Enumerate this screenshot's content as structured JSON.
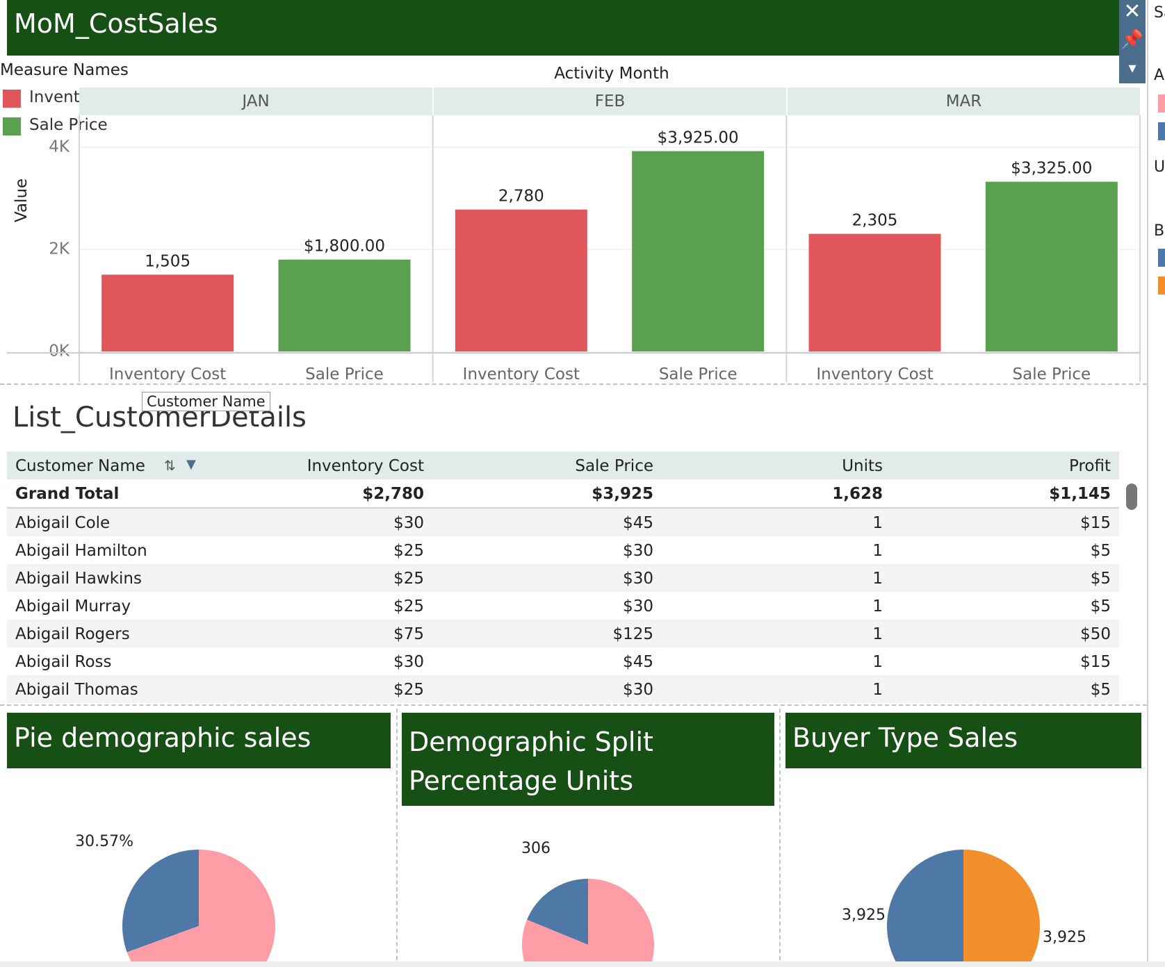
{
  "dashboard": {
    "bar_title": "MoM_CostSales",
    "legend": {
      "title": "Measure Names",
      "items": [
        {
          "label": "Inventory C..",
          "color": "#e0565b"
        },
        {
          "label": "Sale Price",
          "color": "#59a14f"
        }
      ]
    },
    "column_header_title": "Activity Month",
    "y_axis_label": "Value",
    "months": [
      "JAN",
      "FEB",
      "MAR"
    ],
    "x_labels": [
      "Inventory Cost",
      "Sale Price"
    ],
    "tooltip": "Customer Name"
  },
  "chart_data": [
    {
      "type": "bar",
      "categories": [
        "JAN",
        "FEB",
        "MAR"
      ],
      "sub_categories": [
        "Inventory Cost",
        "Sale Price"
      ],
      "series": [
        {
          "name": "Inventory Cost",
          "values": [
            1505,
            2780,
            2305
          ],
          "labels": [
            "1,505",
            "2,780",
            "2,305"
          ],
          "color": "#e0565b"
        },
        {
          "name": "Sale Price",
          "values": [
            1800,
            3925,
            3325
          ],
          "labels": [
            "$1,800.00",
            "$3,925.00",
            "$3,325.00"
          ],
          "color": "#59a14f"
        }
      ],
      "ylabel": "Value",
      "ylim": [
        0,
        4000
      ],
      "yticks": [
        {
          "value": 0,
          "label": "0K"
        },
        {
          "value": 2000,
          "label": "2K"
        },
        {
          "value": 4000,
          "label": "4K"
        }
      ],
      "grid": true
    },
    {
      "type": "pie",
      "title": "Pie demographic sales",
      "slices": [
        {
          "value": 30.57,
          "label": "30.57%",
          "color": "#4e79a7"
        },
        {
          "value": 69.43,
          "label": "",
          "color": "#ff9da7"
        }
      ]
    },
    {
      "type": "pie",
      "title": "Demographic Split Percentage Units",
      "slices": [
        {
          "value": 306,
          "label": "306",
          "color": "#4e79a7"
        },
        {
          "value": 1322,
          "label": "",
          "color": "#ff9da7"
        }
      ]
    },
    {
      "type": "pie",
      "title": "Buyer Type Sales",
      "slices": [
        {
          "value": 3925,
          "label": "3,925",
          "color": "#4e79a7"
        },
        {
          "value": 3925,
          "label": "3,925",
          "color": "#f28e2b"
        }
      ]
    }
  ],
  "table": {
    "title": "List_CustomerDetails",
    "columns": [
      "Customer Name",
      "Inventory Cost",
      "Sale Price",
      "Units",
      "Profit"
    ],
    "grand_total": [
      "Grand Total",
      "$2,780",
      "$3,925",
      "1,628",
      "$1,145"
    ],
    "rows": [
      [
        "Abigail Cole",
        "$30",
        "$45",
        "1",
        "$15"
      ],
      [
        "Abigail Hamilton",
        "$25",
        "$30",
        "1",
        "$5"
      ],
      [
        "Abigail Hawkins",
        "$25",
        "$30",
        "1",
        "$5"
      ],
      [
        "Abigail Murray",
        "$25",
        "$30",
        "1",
        "$5"
      ],
      [
        "Abigail Rogers",
        "$75",
        "$125",
        "1",
        "$50"
      ],
      [
        "Abigail Ross",
        "$30",
        "$45",
        "1",
        "$15"
      ],
      [
        "Abigail Thomas",
        "$25",
        "$30",
        "1",
        "$5"
      ]
    ]
  },
  "colors": {
    "banner": "#175014",
    "header_band": "#e1ecea",
    "inventory": "#e0565b",
    "sale": "#59a14f",
    "pie_blue": "#4e79a7",
    "pie_pink": "#ff9da7",
    "pie_orange": "#f28e2b"
  },
  "side_panel": {
    "partial_labels": [
      "Sa",
      "Ap",
      "U",
      "Bi"
    ],
    "icons": [
      "close-icon",
      "pin-icon",
      "dropdown-icon"
    ]
  }
}
